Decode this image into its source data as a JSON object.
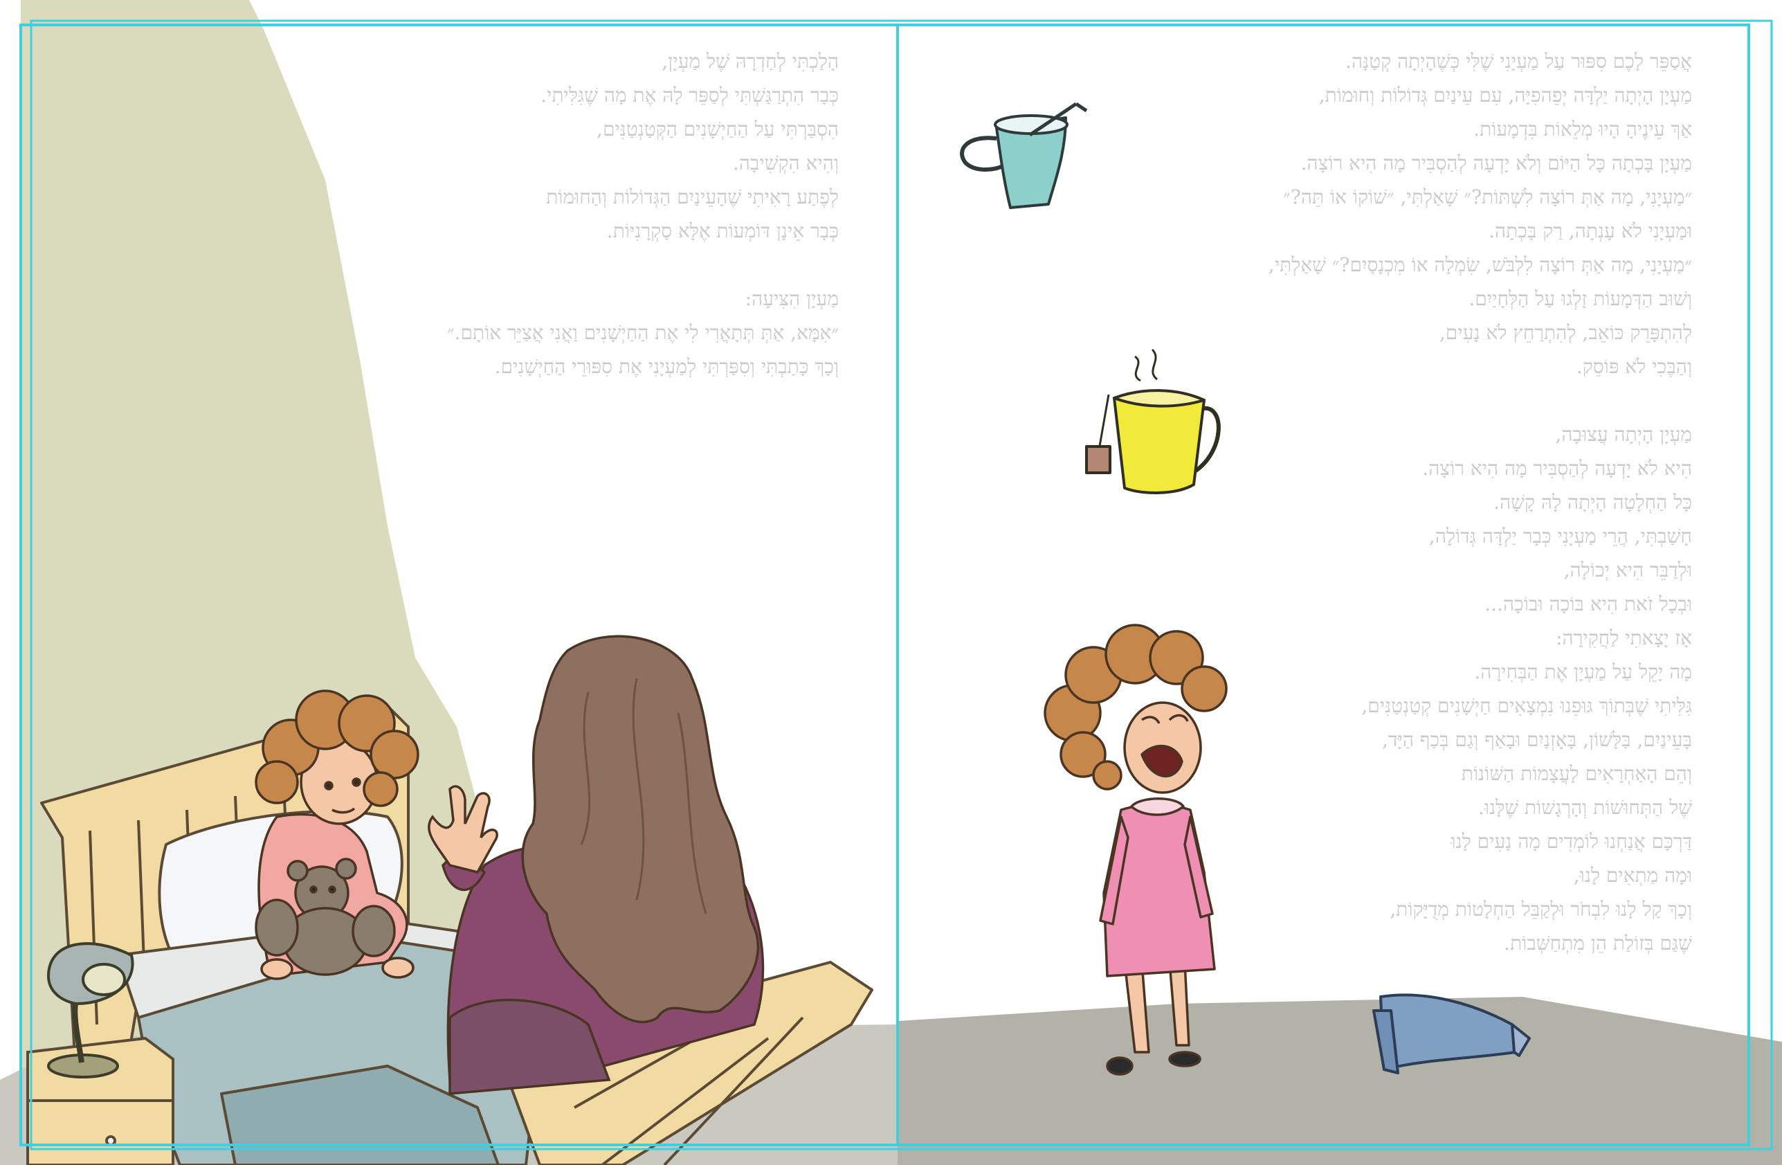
{
  "book": {
    "left_page": {
      "lines": [
        "הָלַכְתִּי לְחַדְרָהּ שֶׁל מַעְיָן,",
        "כְּבָר הִתְרַגַּשְׁתִּי לְסַפֵּר לָהּ אֶת מָה שֶׁגִּלִּיתִי.",
        "הִסְבַּרְתִּי עַל הַחַיְשָׁנִים הַקְּטַנְטַנִּים,",
        "וְהִיא הִקְשִׁיבָה.",
        "לְפֶתַע רָאִיתִי שֶׁהָעֵינַיִם הַגְּדוֹלוֹת וְהַחוּמוֹת",
        "כְּבָר אֵינָן דּוֹמְעוֹת אֶלָּא סַקְרָנִיּוֹת.",
        "",
        "מַעְיָן הִצִּיעָה:",
        "״אִמָּא, אַתְּ תְּתָאֲרִי לִי אֶת הַחַיְשָׁנִים וַאֲנִי אֲצַיֵּר אוֹתָם.״",
        "וְכָךְ כָּתַבְתִּי וְסִפַּרְתִּי לְמַעְיָנִי אֶת סִפּוּרֵי הַחַיְשָׁנִים."
      ]
    },
    "right_page": {
      "lines": [
        "אֲסַפֵּר לָכֶם סִפּוּר עַל מַעְיָנִי שֶׁלִּי כְּשֶׁהָיְתָה קְטַנָּה.",
        "מַעְיָן הָיְתָה יַלְדָּה יְפֵהפִיָּה, עִם עֵינַיִם גְּדוֹלוֹת וְחוּמוֹת,",
        "אַךְ עֵינֶיהָ הָיוּ מְלֵאוֹת בִּדְמָעוֹת.",
        "מַעְיָן בָּכְתָה כָּל הַיּוֹם וְלֹא יָדְעָה לְהַסְבִּיר מָה הִיא רוֹצָה.",
        "״מַעְיָנִי, מָה אַתְּ רוֹצָה לִשְׁתּוֹת?״ שָׁאַלְתִּי, ״שׁוֹקוֹ אוֹ תֵּה?״",
        "וּמַעְיָנִי לֹא עָנְתָה, רַק בָּכְתָה.",
        "״מַעְיָנִי, מָה אַתְּ רוֹצָה לִלְבֹּשׁ, שִׂמְלָה אוֹ מִכְנָסַיִם?״ שָׁאַלְתִּי,",
        "וְשׁוּב הַדְּמָעוֹת זָלְגוּ עַל הַלְּחָיַיִם.",
        "לְהִתְפָּרֵק כּוֹאֵב, לְהִתְרַחֵץ לֹא נָעִים,",
        "וְהַבֶּכִי לֹא פּוֹסֵק.",
        "",
        "מַעְיָן הָיְתָה עֲצוּבָה,",
        "הִיא לֹא יָדְעָה לְהַסְבִּיר מָה הִיא רוֹצָה.",
        "כָּל הַחְלָטָה הָיְתָה לָהּ קָשָׁה.",
        "חָשַׁבְתִּי, הֲרֵי מַעְיָנִי כְּבָר יַלְדָּה גְּדוֹלָה,",
        "וּלְדַבֵּר הִיא יְכוֹלָה,",
        "וּבְכָל זֹאת הִיא בּוֹכָה וּבוֹכָה...",
        "אָז יָצָאתִי לַחֲקִירָה:",
        "מָה יָקֵל עַל מַעְיָן אֶת הַבְּחִירָה.",
        "גִּלִּיתִי שֶׁבְּתוֹךְ גּוּפֵנוּ נִמְצָאִים חַיְשָׁנִים קְטַנְטַנִּים,",
        "בָּעֵינַיִם, בַּלָּשׁוֹן, בָּאָזְנַיִם וּבָאַף וְגַם בְּכַף הַיָּד,",
        "וְהֵם הָאַחְרָאִים לָעֲצָמוֹת הַשּׁוֹנוֹת",
        "שֶׁל הַתְּחוּשׁוֹת וְהָרְגָשׁוֹת שֶׁלָּנוּ.",
        "דַּרְכָּם אֲנַחְנוּ לוֹמְדִים מָה נָעִים לָנוּ",
        "וּמָה מַתְאִים לָנוּ,",
        "וְכָךְ קַל לָנוּ לִבְחֹר וּלְקַבֵּל הַחְלָטוֹת מְדֻיָּקוֹת,",
        "שֶׁגַּם בְּזוֹלַת הֵן מִתְחַשְּׁבוֹת."
      ]
    }
  },
  "colors": {
    "frame_cyan": "#3fd0e0",
    "wall_green": "#dadbbd",
    "floor_gray": "#acaca4",
    "text_gray": "#c9c9c9",
    "curls_orange": "#c6874a",
    "mother_hair": "#8f7060",
    "mother_sweater": "#8a4a6e",
    "blanket": "#a9c1c2",
    "bed_wood": "#f1dba2",
    "dress_pink": "#ef8fb4",
    "mug_teal": "#8ccfcb",
    "pitcher_yellow": "#f2ea3a",
    "jeans_blue": "#7f9fc3"
  },
  "illustrations": {
    "left": [
      "bed",
      "girl-with-teddy-bear",
      "mother",
      "lamp",
      "nightstand"
    ],
    "right": [
      "cup-with-straw",
      "tea-pitcher",
      "crying-girl",
      "jeans"
    ]
  }
}
